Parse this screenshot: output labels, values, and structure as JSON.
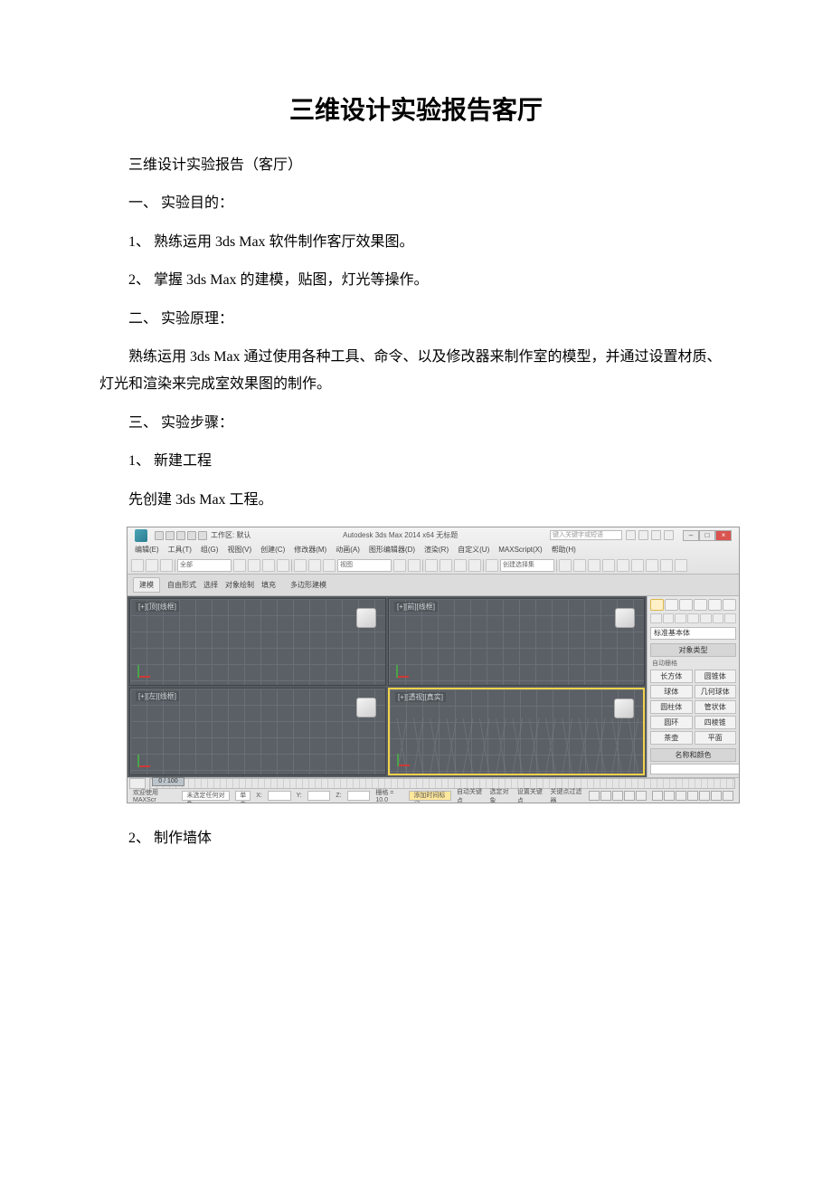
{
  "doc": {
    "title": "三维设计实验报告客厅",
    "p1": "三维设计实验报告（客厅）",
    "p2": "一、 实验目的：",
    "p3": "1、 熟练运用 3ds Max 软件制作客厅效果图。",
    "p4": "2、 掌握 3ds Max 的建模，贴图，灯光等操作。",
    "p5": "二、 实验原理：",
    "p6": "熟练运用 3ds Max 通过使用各种工具、命令、以及修改器来制作室的模型，并通过设置材质、灯光和渲染来完成室效果图的制作。",
    "p7": "三、 实验步骤：",
    "p8": "1、 新建工程",
    "p9": "先创建 3ds Max 工程。",
    "p10": "2、 制作墙体"
  },
  "app": {
    "title_center": "Autodesk 3ds Max  2014 x64   无标题",
    "workspace": "工作区: 默认",
    "search_placeholder": "键入关键字或短语",
    "menu": [
      "编辑(E)",
      "工具(T)",
      "组(G)",
      "视图(V)",
      "创建(C)",
      "修改器(M)",
      "动画(A)",
      "图形编辑器(D)",
      "渲染(R)",
      "自定义(U)",
      "MAXScript(X)",
      "帮助(H)"
    ],
    "toolbar_dd": "视图",
    "ribbon_tabs": [
      "建模",
      "自由形式",
      "选择",
      "对象绘制",
      "填充"
    ],
    "ribbon_sub": "多边形建模",
    "viewports": {
      "tl": "[+][顶][线框]",
      "tr": "[+][前][线框]",
      "bl": "[+][左][线框]",
      "br": "[+][透视][真实]"
    },
    "cmd": {
      "dropdown": "标准基本体",
      "rollout": "对象类型",
      "autogrid": "自动栅格",
      "objects": [
        "长方体",
        "圆锥体",
        "球体",
        "几何球体",
        "圆柱体",
        "管状体",
        "圆环",
        "四棱锥",
        "茶壶",
        "平面"
      ],
      "name_color": "名称和颜色"
    },
    "timeline_slider": "0 / 100",
    "status": {
      "welcome": "欢迎使用 MAXScr",
      "hint_no_sel": "未选定任何对象",
      "hint_click": "单击或单击并拖动以选择对象",
      "x": "X:",
      "y": "Y:",
      "z": "Z:",
      "grid": "栅格 = 10.0",
      "add_tag": "添加时间标记",
      "autokey": "自动关键点",
      "selected": "选定对象",
      "setkey": "设置关键点",
      "keyfilter": "关键点过滤器"
    }
  }
}
